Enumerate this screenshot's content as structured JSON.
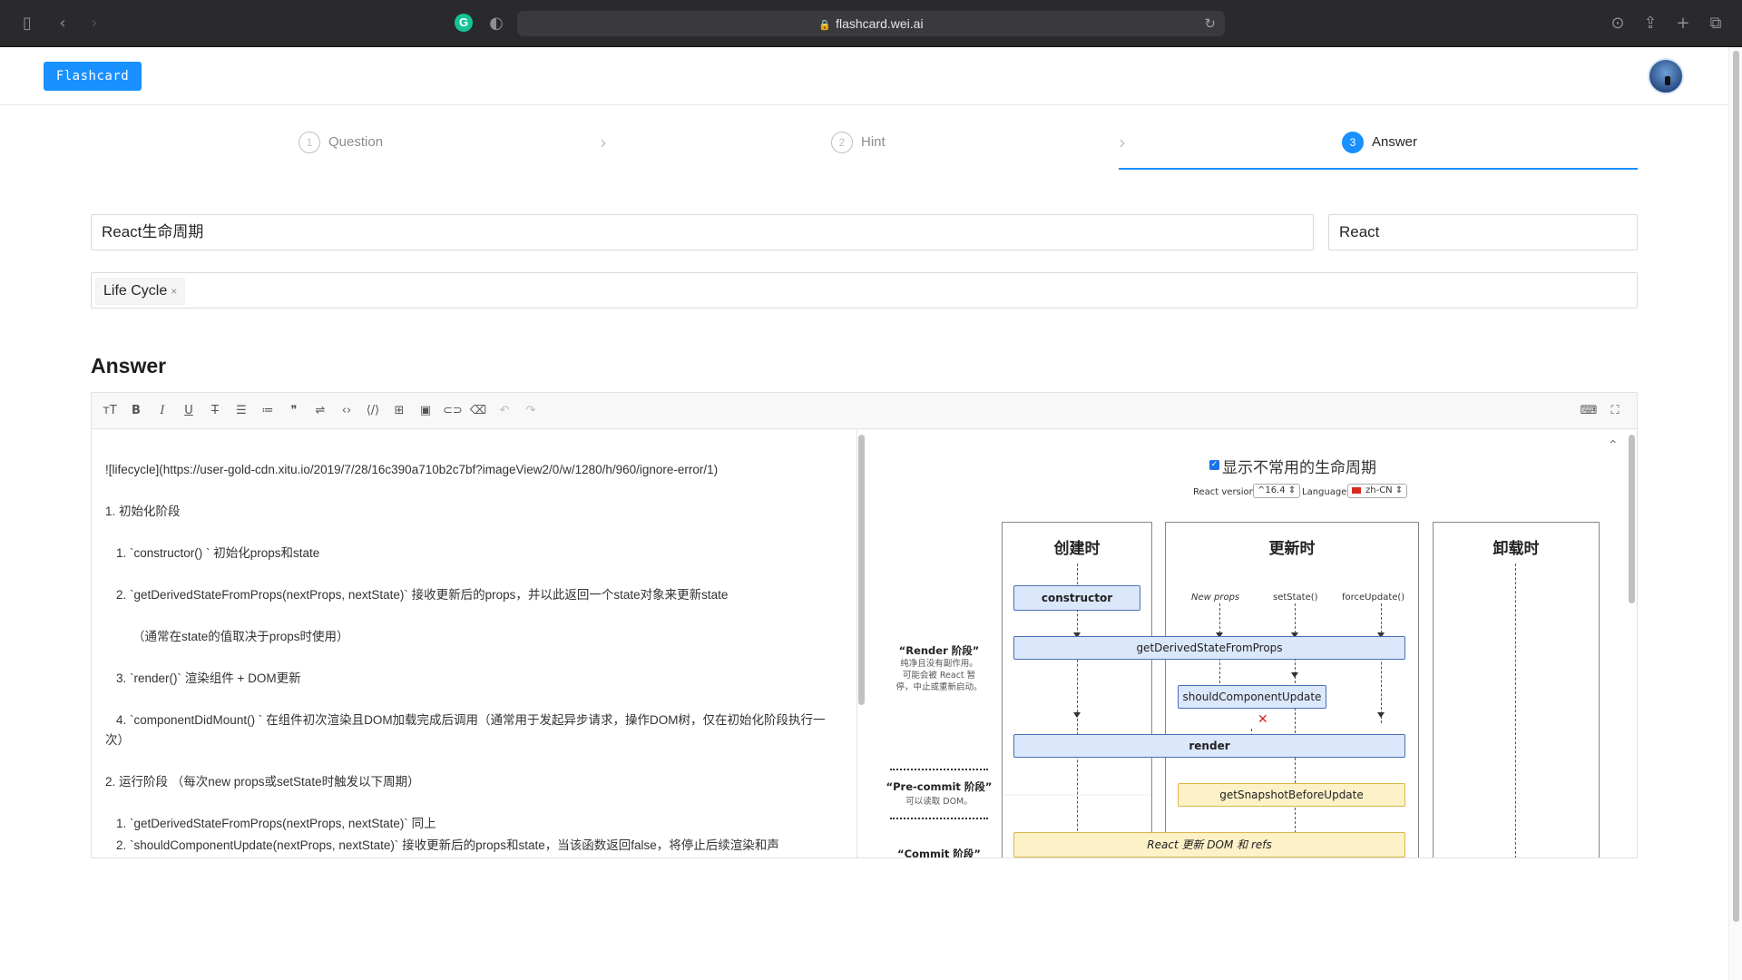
{
  "browser": {
    "url": "flashcard.wei.ai"
  },
  "header": {
    "logo_label": "Flashcard"
  },
  "steps": [
    {
      "num": "1",
      "label": "Question"
    },
    {
      "num": "2",
      "label": "Hint"
    },
    {
      "num": "3",
      "label": "Answer"
    }
  ],
  "form": {
    "question_value": "React生命周期",
    "category_value": "React",
    "tags": [
      {
        "label": "Life Cycle",
        "remove": "×"
      }
    ]
  },
  "answer": {
    "section_title": "Answer"
  },
  "editor": {
    "lines": [
      "![lifecycle](https://user-gold-cdn.xitu.io/2019/7/28/16c390a710b2c7bf?imageView2/0/w/1280/h/960/ignore-error/1)",
      "1. 初始化阶段",
      "   1. `constructor() ` 初始化props和state",
      "   2. `getDerivedStateFromProps(nextProps, nextState)` 接收更新后的props，并以此返回一个state对象来更新state",
      "      （通常在state的值取决于props时使用）",
      "   3. `render()` 渲染组件 + DOM更新",
      "   4. `componentDidMount() ` 在组件初次渲染且DOM加载完成后调用（通常用于发起异步请求，操作DOM树，仅在初始化阶段执行一次）",
      "2. 运行阶段 （每次new props或setState时触发以下周期）",
      "   1. `getDerivedStateFromProps(nextProps, nextState)` 同上",
      "   2. `shouldComponentUpdate(nextProps, nextState)` 接收更新后的props和state，当该函数返回false，将停止后续渲染和声"
    ]
  },
  "diagram": {
    "title": "显示不常用的生命周期",
    "react_version_label": "React version",
    "react_version_value": "^16.4",
    "language_label": "Language",
    "language_value": "zh-CN",
    "columns": [
      "创建时",
      "更新时",
      "卸载时"
    ],
    "triggers": [
      "New props",
      "setState()",
      "forceUpdate()"
    ],
    "boxes": {
      "constructor": "constructor",
      "gdsfp": "getDerivedStateFromProps",
      "scu": "shouldComponentUpdate",
      "render": "render",
      "gsbu": "getSnapshotBeforeUpdate",
      "commit": "React 更新 DOM 和 refs"
    },
    "phases": {
      "render_title": "“Render 阶段”",
      "render_note_1": "纯净且没有副作用。",
      "render_note_2": "可能会被 React 暂",
      "render_note_3": "停，中止或重新启动。",
      "precommit_title": "“Pre-commit 阶段”",
      "precommit_note": "可以读取 DOM。",
      "commit_title": "“Commit 阶段”"
    }
  }
}
